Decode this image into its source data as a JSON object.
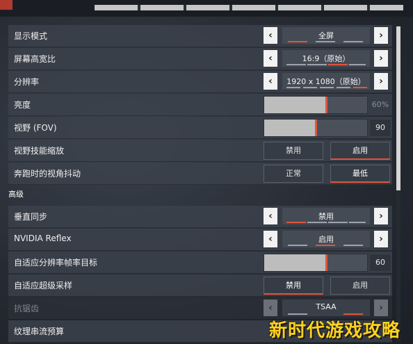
{
  "section_general": {
    "display_mode": {
      "label": "显示模式",
      "value": "全屏"
    },
    "aspect_ratio": {
      "label": "屏幕高宽比",
      "value": "16:9（原始）"
    },
    "resolution": {
      "label": "分辨率",
      "value": "1920 x 1080（原始）"
    },
    "brightness": {
      "label": "亮度",
      "value": "60%",
      "level": 0.6
    },
    "fov": {
      "label": "视野 (FOV)",
      "value": "90",
      "level": 0.5
    },
    "fov_ability_scaling": {
      "label": "视野技能缩放",
      "options": [
        "禁用",
        "启用"
      ],
      "selected": "启用"
    },
    "sprint_view_shake": {
      "label": "奔跑时的视角抖动",
      "options": [
        "正常",
        "最低"
      ],
      "selected": "最低"
    }
  },
  "section_advanced": {
    "title": "高级",
    "vsync": {
      "label": "垂直同步",
      "value": "禁用"
    },
    "nvidia_reflex": {
      "label": "NVIDIA Reflex",
      "value": "启用"
    },
    "adaptive_resolution": {
      "label": "自适应分辨率帧率目标",
      "value": "60",
      "level": 0.6
    },
    "adaptive_supersampling": {
      "label": "自适应超级采样",
      "options": [
        "禁用",
        "启用"
      ],
      "selected": "禁用"
    },
    "anti_aliasing": {
      "label": "抗锯齿",
      "value": "TSAA"
    },
    "texture_streaming": {
      "label": "纹理串流预算"
    }
  },
  "watermark": "新时代游戏攻略",
  "colors": {
    "accent": "#e0553c",
    "row_bg": "#3c424c",
    "arrow_bg": "#f2f2f2"
  },
  "icons": {
    "prev": "chevron-left-icon",
    "next": "chevron-right-icon"
  }
}
